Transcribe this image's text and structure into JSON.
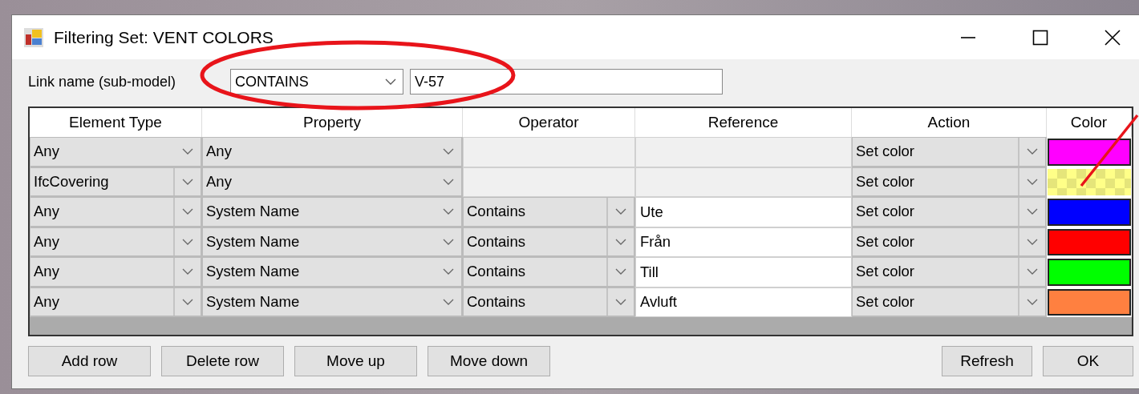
{
  "window": {
    "title": "Filtering Set: VENT COLORS"
  },
  "link": {
    "label": "Link name (sub-model)",
    "operator": "CONTAINS",
    "value": "V-57"
  },
  "table": {
    "columns": [
      "Element Type",
      "Property",
      "Operator",
      "Reference",
      "Action",
      "Color"
    ],
    "rows": [
      {
        "element_type": "Any",
        "property": "Any",
        "operator": null,
        "reference": null,
        "action": "Set color",
        "color": "#ff00ff",
        "checkered": false
      },
      {
        "element_type": "IfcCovering",
        "property": "Any",
        "operator": null,
        "reference": null,
        "action": "Set color",
        "color": "#ffff88",
        "checkered": true
      },
      {
        "element_type": "Any",
        "property": "System Name",
        "operator": "Contains",
        "reference": "Ute",
        "action": "Set color",
        "color": "#0000ff",
        "checkered": false
      },
      {
        "element_type": "Any",
        "property": "System Name",
        "operator": "Contains",
        "reference": "Från",
        "action": "Set color",
        "color": "#ff0000",
        "checkered": false
      },
      {
        "element_type": "Any",
        "property": "System Name",
        "operator": "Contains",
        "reference": "Till",
        "action": "Set color",
        "color": "#00ff00",
        "checkered": false
      },
      {
        "element_type": "Any",
        "property": "System Name",
        "operator": "Contains",
        "reference": "Avluft",
        "action": "Set color",
        "color": "#ff8040",
        "checkered": false
      }
    ]
  },
  "left_buttons": [
    "Add row",
    "Delete row",
    "Move up",
    "Move down"
  ],
  "right_buttons": [
    "Refresh",
    "OK"
  ]
}
